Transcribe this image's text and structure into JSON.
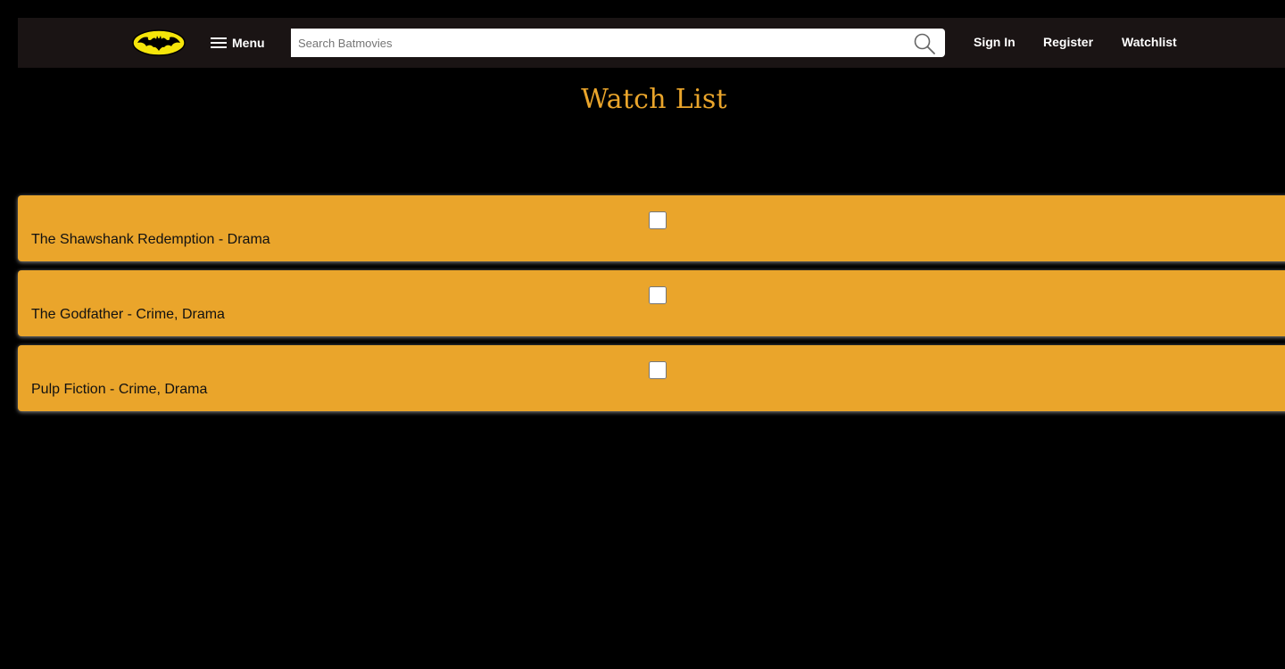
{
  "header": {
    "logo_name": "bat-logo",
    "menu_label": "Menu",
    "search": {
      "placeholder": "Search Batmovies",
      "value": ""
    },
    "nav": {
      "sign_in": "Sign In",
      "register": "Register",
      "watchlist": "Watchlist"
    }
  },
  "page": {
    "title": "Watch List"
  },
  "watchlist": {
    "items": [
      {
        "label": "The Shawshank Redemption - Drama",
        "checked": false
      },
      {
        "label": "The Godfather - Crime, Drama",
        "checked": false
      },
      {
        "label": "Pulp Fiction - Crime, Drama",
        "checked": false
      }
    ]
  },
  "colors": {
    "background": "#000000",
    "topbar": "#1a1414",
    "accent": "#eaa52b",
    "logo_yellow": "#f5e50a"
  }
}
